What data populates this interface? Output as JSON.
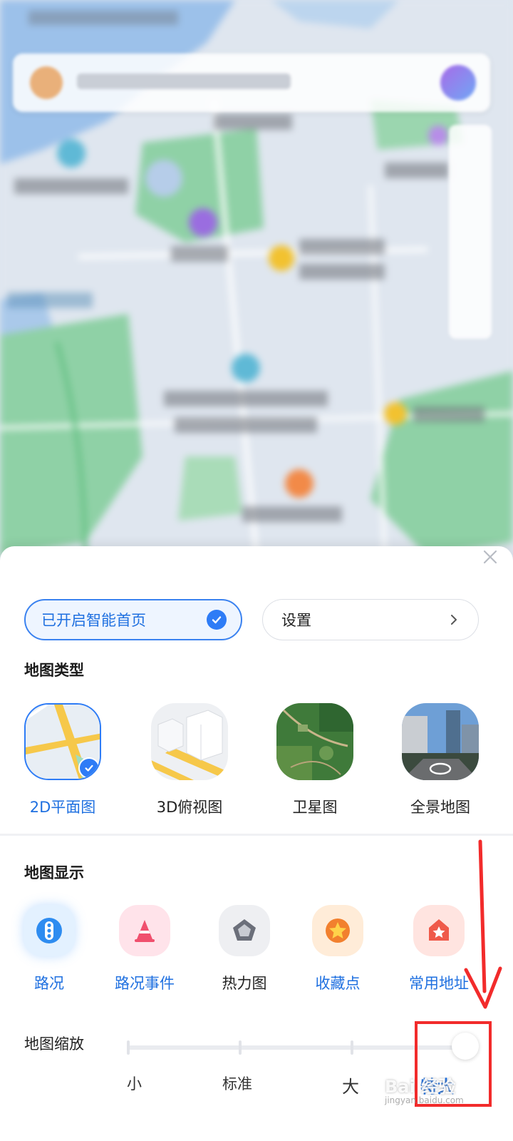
{
  "sheet": {
    "smart_home_label": "已开启智能首页",
    "settings_label": "设置"
  },
  "map_type": {
    "title": "地图类型",
    "items": [
      {
        "label": "2D平面图",
        "selected": true
      },
      {
        "label": "3D俯视图",
        "selected": false
      },
      {
        "label": "卫星图",
        "selected": false
      },
      {
        "label": "全景地图",
        "selected": false
      }
    ]
  },
  "map_display": {
    "title": "地图显示",
    "items": [
      {
        "label": "路况",
        "icon": "traffic-light-icon",
        "enabled": true,
        "color": "#2e8cf0"
      },
      {
        "label": "路况事件",
        "icon": "traffic-cone-icon",
        "enabled": true,
        "color": "#f0506e"
      },
      {
        "label": "热力图",
        "icon": "pentagon-icon",
        "enabled": false,
        "color": "#6b6f7a"
      },
      {
        "label": "收藏点",
        "icon": "star-icon",
        "enabled": true,
        "color": "#f2802e"
      },
      {
        "label": "常用地址",
        "icon": "home-icon",
        "enabled": true,
        "color": "#ef5a4a"
      }
    ]
  },
  "zoom": {
    "label": "地图缩放",
    "options": [
      "小",
      "标准",
      "大",
      "特大"
    ],
    "selected": "特大"
  },
  "watermark": {
    "text": "Bai 经验",
    "sub": "jingyan.baidu.com"
  },
  "colors": {
    "accent": "#2e7cf6",
    "annotation": "#f22b2b"
  }
}
